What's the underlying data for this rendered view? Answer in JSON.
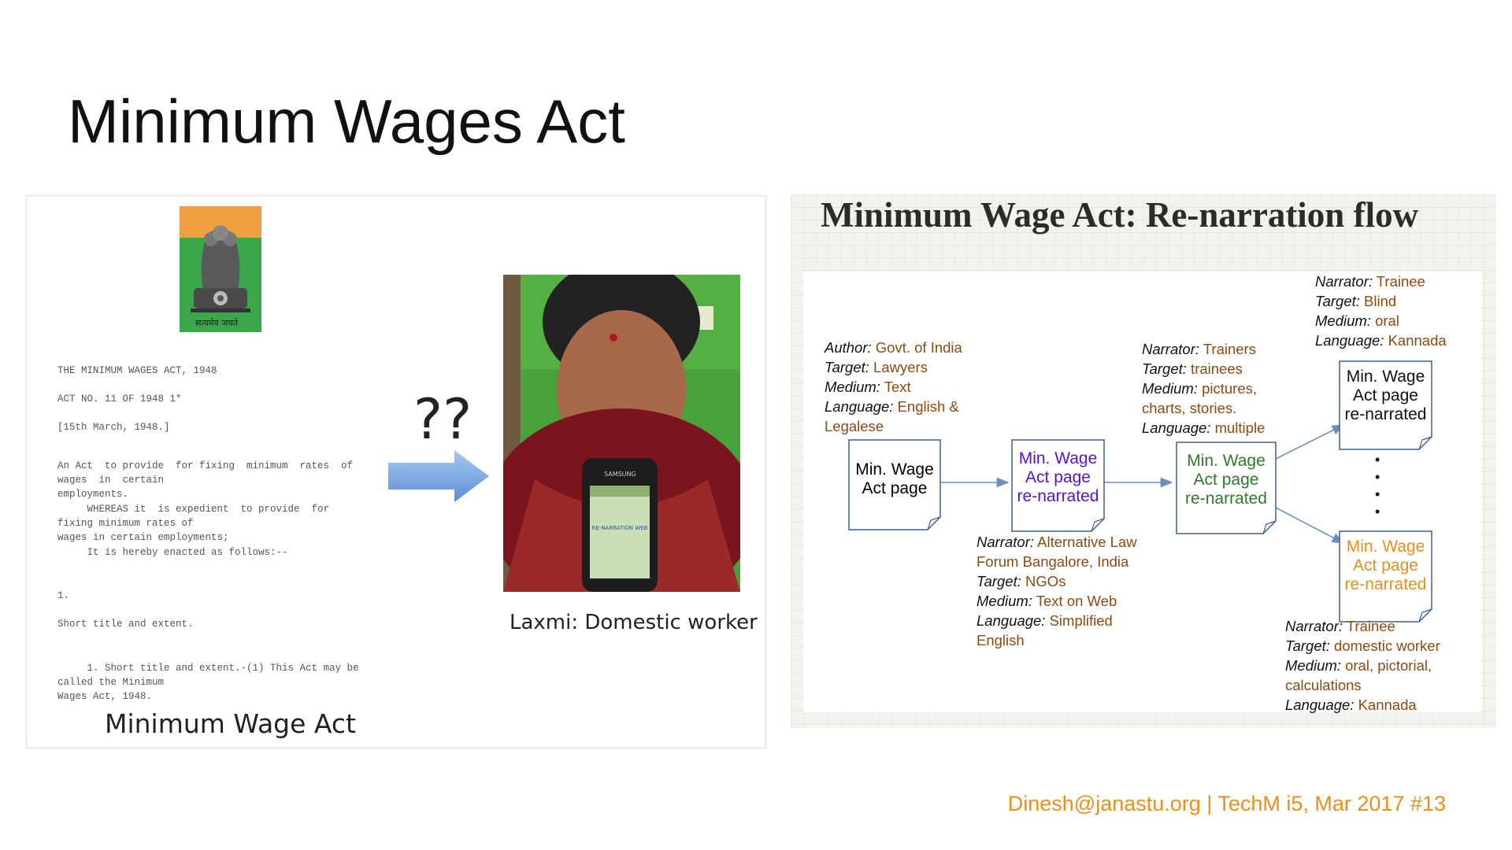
{
  "slide_title": "Minimum Wages Act",
  "footer": "Dinesh@janastu.org | TechM i5, Mar 2017 #13",
  "left_panel": {
    "emblem_text": "सत्यमेव जयते",
    "document_lines": [
      "THE MINIMUM WAGES ACT, 1948",
      "ACT NO. 11 OF 1948 1*",
      "[15th March, 1948.]",
      "An Act  to provide  for fixing  minimum  rates  of  wages  in  certain\nemployments.",
      "     WHEREAS it  is expedient  to provide  for fixing minimum rates of\nwages in certain employments;",
      "     It is hereby enacted as follows:--",
      "1.",
      "Short title and extent.",
      "     1. Short title and extent.-(1) This Act may be called the Minimum\nWages Act, 1948."
    ],
    "question_marks": "??",
    "photo_caption": "Laxmi: Domestic worker",
    "phone_brand": "SAMSUNG",
    "phone_screen_text": "RE-NARRATION WEB",
    "caption": "Minimum Wage Act"
  },
  "right_panel": {
    "title": "Minimum Wage Act: Re-narration flow",
    "nodes": [
      {
        "lines": [
          "Min. Wage",
          "Act page"
        ],
        "color": "#111111"
      },
      {
        "lines": [
          "Min. Wage",
          "Act page",
          "re-narrated"
        ],
        "color": "#5a12c8"
      },
      {
        "lines": [
          "Min. Wage",
          "Act page",
          "re-narrated"
        ],
        "color": "#2f7a2a"
      },
      {
        "lines": [
          "Min. Wage",
          "Act page",
          "re-narrated"
        ],
        "color": "#111111"
      },
      {
        "lines": [
          "Min. Wage",
          "Act page",
          "re-narrated"
        ],
        "color": "#e8901a"
      }
    ],
    "dots": "•\n•\n•\n•",
    "infos": [
      {
        "lines": [
          [
            "Author:",
            " Govt. of India"
          ],
          [
            "Target:",
            " Lawyers"
          ],
          [
            "Medium:",
            " Text"
          ],
          [
            "Language:",
            " English &"
          ],
          [
            "",
            "Legalese"
          ]
        ]
      },
      {
        "lines": [
          [
            "Narrator:",
            " Alternative Law"
          ],
          [
            "",
            "Forum  Bangalore, India"
          ],
          [
            "Target:",
            " NGOs"
          ],
          [
            "Medium:",
            " Text on Web"
          ],
          [
            "Language:",
            " Simplified"
          ],
          [
            "",
            "English"
          ]
        ]
      },
      {
        "lines": [
          [
            "Narrator:",
            " Trainers"
          ],
          [
            "Target:",
            " trainees"
          ],
          [
            "Medium:",
            " pictures,"
          ],
          [
            "",
            "charts, stories."
          ],
          [
            "Language:",
            " multiple"
          ]
        ]
      },
      {
        "lines": [
          [
            "Narrator:",
            " Trainee"
          ],
          [
            "Target:",
            " Blind"
          ],
          [
            "Medium:",
            " oral"
          ],
          [
            "Language:",
            " Kannada"
          ]
        ]
      },
      {
        "lines": [
          [
            "Narrator:",
            " Trainee"
          ],
          [
            "Target:",
            " domestic worker"
          ],
          [
            "Medium:",
            " oral, pictorial,"
          ],
          [
            "",
            "calculations"
          ],
          [
            "Language:",
            " Kannada"
          ]
        ]
      }
    ]
  }
}
